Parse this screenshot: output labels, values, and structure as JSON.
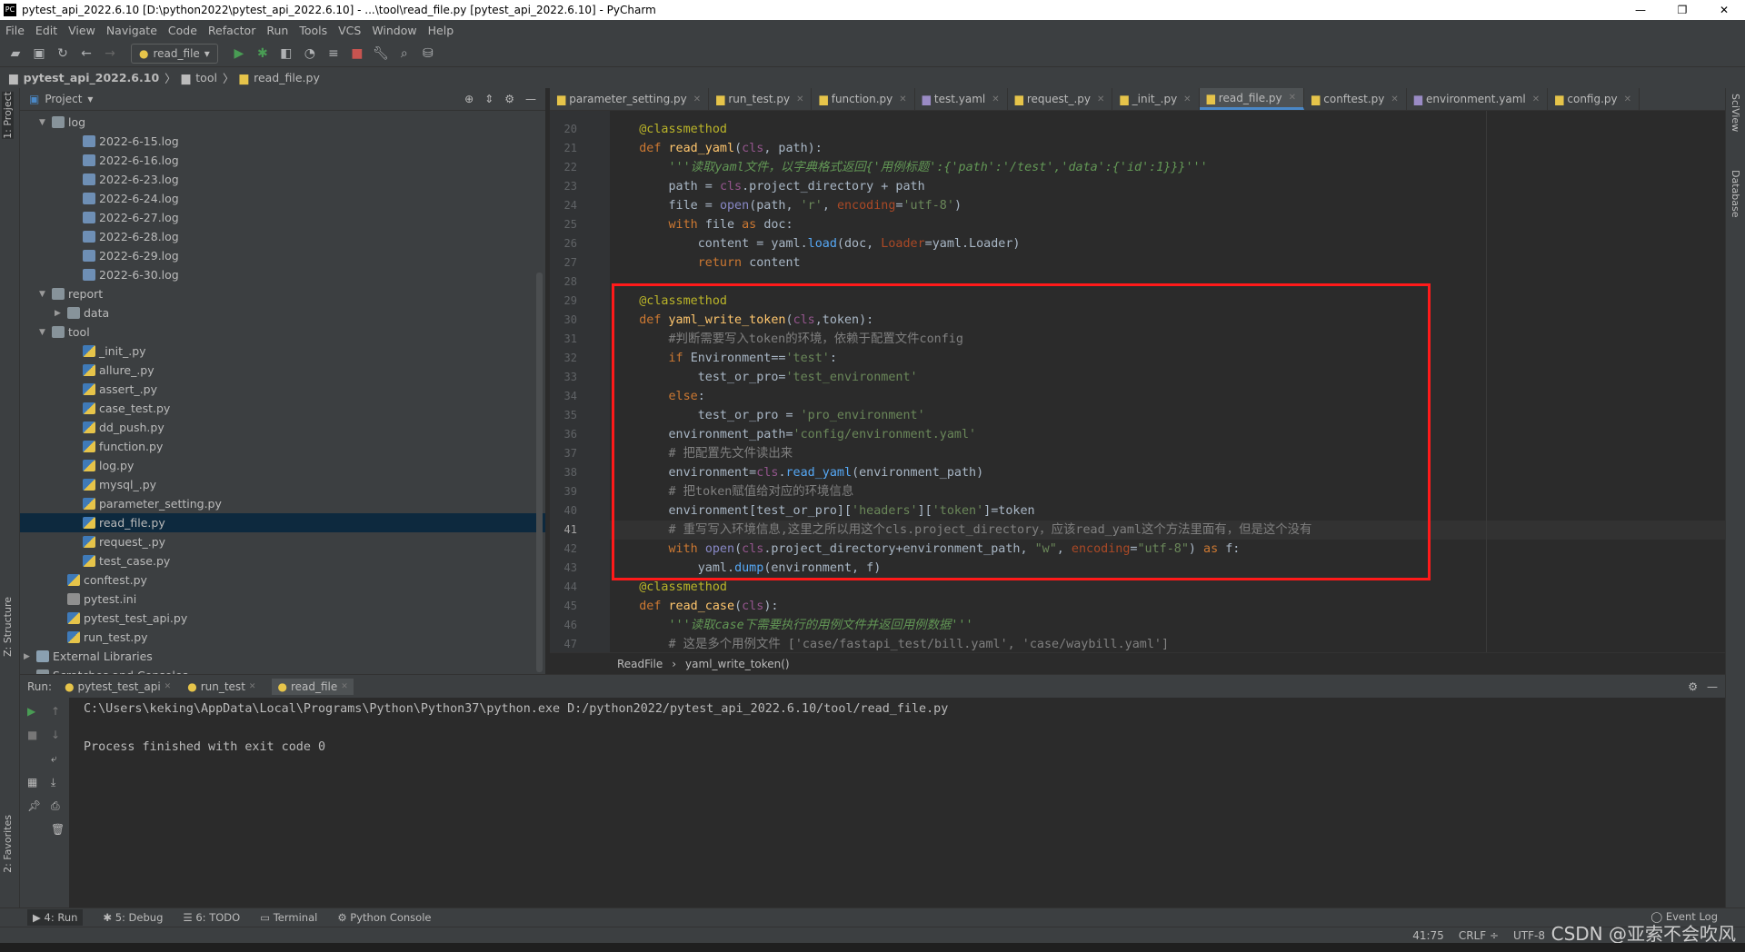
{
  "window": {
    "title": "pytest_api_2022.6.10 [D:\\python2022\\pytest_api_2022.6.10] - ...\\tool\\read_file.py [pytest_api_2022.6.10] - PyCharm",
    "app_icon": "PC"
  },
  "menu": [
    "File",
    "Edit",
    "View",
    "Navigate",
    "Code",
    "Refactor",
    "Run",
    "Tools",
    "VCS",
    "Window",
    "Help"
  ],
  "toolbar": {
    "run_config": "read_file"
  },
  "breadcrumb": [
    "pytest_api_2022.6.10",
    "tool",
    "read_file.py"
  ],
  "left_strip": {
    "project": "1: Project",
    "structure": "Z: Structure",
    "favorites": "2: Favorites"
  },
  "project": {
    "title": "Project",
    "tree": [
      {
        "label": "log",
        "depth": 1,
        "type": "folder",
        "arrow": "▼"
      },
      {
        "label": "2022-6-15.log",
        "depth": 3,
        "type": "log"
      },
      {
        "label": "2022-6-16.log",
        "depth": 3,
        "type": "log"
      },
      {
        "label": "2022-6-23.log",
        "depth": 3,
        "type": "log"
      },
      {
        "label": "2022-6-24.log",
        "depth": 3,
        "type": "log"
      },
      {
        "label": "2022-6-27.log",
        "depth": 3,
        "type": "log"
      },
      {
        "label": "2022-6-28.log",
        "depth": 3,
        "type": "log"
      },
      {
        "label": "2022-6-29.log",
        "depth": 3,
        "type": "log"
      },
      {
        "label": "2022-6-30.log",
        "depth": 3,
        "type": "log"
      },
      {
        "label": "report",
        "depth": 1,
        "type": "folder",
        "arrow": "▼"
      },
      {
        "label": "data",
        "depth": 2,
        "type": "folder",
        "arrow": "▶"
      },
      {
        "label": "tool",
        "depth": 1,
        "type": "folder",
        "arrow": "▼"
      },
      {
        "label": "_init_.py",
        "depth": 3,
        "type": "py"
      },
      {
        "label": "allure_.py",
        "depth": 3,
        "type": "py"
      },
      {
        "label": "assert_.py",
        "depth": 3,
        "type": "py"
      },
      {
        "label": "case_test.py",
        "depth": 3,
        "type": "py"
      },
      {
        "label": "dd_push.py",
        "depth": 3,
        "type": "py"
      },
      {
        "label": "function.py",
        "depth": 3,
        "type": "py"
      },
      {
        "label": "log.py",
        "depth": 3,
        "type": "py"
      },
      {
        "label": "mysql_.py",
        "depth": 3,
        "type": "py"
      },
      {
        "label": "parameter_setting.py",
        "depth": 3,
        "type": "py"
      },
      {
        "label": "read_file.py",
        "depth": 3,
        "type": "py",
        "selected": true
      },
      {
        "label": "request_.py",
        "depth": 3,
        "type": "py"
      },
      {
        "label": "test_case.py",
        "depth": 3,
        "type": "py"
      },
      {
        "label": "conftest.py",
        "depth": 2,
        "type": "py"
      },
      {
        "label": "pytest.ini",
        "depth": 2,
        "type": "ini"
      },
      {
        "label": "pytest_test_api.py",
        "depth": 2,
        "type": "py"
      },
      {
        "label": "run_test.py",
        "depth": 2,
        "type": "py"
      },
      {
        "label": "External Libraries",
        "depth": 0,
        "type": "lib",
        "arrow": "▶"
      },
      {
        "label": "Scratches and Consoles",
        "depth": 0,
        "type": "folder"
      }
    ]
  },
  "tabs": [
    {
      "label": "parameter_setting.py"
    },
    {
      "label": "run_test.py"
    },
    {
      "label": "function.py"
    },
    {
      "label": "test.yaml"
    },
    {
      "label": "request_.py"
    },
    {
      "label": "_init_.py"
    },
    {
      "label": "read_file.py",
      "active": true
    },
    {
      "label": "conftest.py"
    },
    {
      "label": "environment.yaml"
    },
    {
      "label": "config.py"
    }
  ],
  "editor": {
    "first_line": 20,
    "current_line": 41,
    "lines": [
      [
        [
          "    "
        ],
        [
          "@classmethod",
          "dec"
        ]
      ],
      [
        [
          "    "
        ],
        [
          "def ",
          "kw"
        ],
        [
          "read_yaml",
          "fn"
        ],
        [
          "("
        ],
        [
          "cls",
          "self"
        ],
        [
          ", path):"
        ]
      ],
      [
        [
          "        "
        ],
        [
          "'''读取yaml文件，以字典格式返回{'用例标题':{'path':'/test','data':{'id':1}}}'''",
          "doc"
        ]
      ],
      [
        [
          "        path = "
        ],
        [
          "cls",
          "self"
        ],
        [
          ".project_directory + path"
        ]
      ],
      [
        [
          "        file = "
        ],
        [
          "open",
          "bi"
        ],
        [
          "(path, "
        ],
        [
          "'r'",
          "str"
        ],
        [
          ", "
        ],
        [
          "encoding",
          "param"
        ],
        [
          "="
        ],
        [
          "'utf-8'",
          "str"
        ],
        [
          ")"
        ]
      ],
      [
        [
          "        "
        ],
        [
          "with ",
          "kw"
        ],
        [
          "file "
        ],
        [
          "as ",
          "kw"
        ],
        [
          "doc:"
        ]
      ],
      [
        [
          "            content = yaml."
        ],
        [
          "load",
          "call"
        ],
        [
          "(doc, "
        ],
        [
          "Loader",
          "param"
        ],
        [
          "=yaml.Loader)"
        ]
      ],
      [
        [
          "            "
        ],
        [
          "return ",
          "kw"
        ],
        [
          "content"
        ]
      ],
      [
        [
          ""
        ]
      ],
      [
        [
          "    "
        ],
        [
          "@classmethod",
          "dec"
        ]
      ],
      [
        [
          "    "
        ],
        [
          "def ",
          "kw"
        ],
        [
          "yaml_write_token",
          "fn"
        ],
        [
          "("
        ],
        [
          "cls",
          "self"
        ],
        [
          ",token):"
        ]
      ],
      [
        [
          "        "
        ],
        [
          "#判断需要写入token的环境，依赖于配置文件config",
          "cm"
        ]
      ],
      [
        [
          "        "
        ],
        [
          "if ",
          "kw"
        ],
        [
          "Environment=="
        ],
        [
          "'test'",
          "str"
        ],
        [
          ":"
        ]
      ],
      [
        [
          "            test_or_pro="
        ],
        [
          "'test_environment'",
          "str"
        ]
      ],
      [
        [
          "        "
        ],
        [
          "else",
          "kw"
        ],
        [
          ":"
        ]
      ],
      [
        [
          "            test_or_pro = "
        ],
        [
          "'pro_environment'",
          "str"
        ]
      ],
      [
        [
          "        environment_path="
        ],
        [
          "'config/environment.yaml'",
          "str"
        ]
      ],
      [
        [
          "        "
        ],
        [
          "# 把配置先文件读出来",
          "cm"
        ]
      ],
      [
        [
          "        environment="
        ],
        [
          "cls",
          "self"
        ],
        [
          "."
        ],
        [
          "read_yaml",
          "call"
        ],
        [
          "(environment_path)"
        ]
      ],
      [
        [
          "        "
        ],
        [
          "# 把token赋值给对应的环境信息",
          "cm"
        ]
      ],
      [
        [
          "        environment[test_or_pro]["
        ],
        [
          "'headers'",
          "str"
        ],
        [
          "]["
        ],
        [
          "'token'",
          "str"
        ],
        [
          "]=token"
        ]
      ],
      [
        [
          "        "
        ],
        [
          "# 重写写入环境信息,这里之所以用这个cls.project_directory，应该read_yaml这个方法里面有，但是这个没有",
          "cm"
        ]
      ],
      [
        [
          "        "
        ],
        [
          "with ",
          "kw"
        ],
        [
          "open",
          "bi"
        ],
        [
          "("
        ],
        [
          "cls",
          "self"
        ],
        [
          ".project_directory+environment_path, "
        ],
        [
          "\"w\"",
          "str"
        ],
        [
          ", "
        ],
        [
          "encoding",
          "param"
        ],
        [
          "="
        ],
        [
          "\"utf-8\"",
          "str"
        ],
        [
          ") "
        ],
        [
          "as ",
          "kw"
        ],
        [
          "f:"
        ]
      ],
      [
        [
          "            yaml."
        ],
        [
          "dump",
          "call"
        ],
        [
          "(environment, f)"
        ]
      ],
      [
        [
          "    "
        ],
        [
          "@classmethod",
          "dec"
        ]
      ],
      [
        [
          "    "
        ],
        [
          "def ",
          "kw"
        ],
        [
          "read_case",
          "fn"
        ],
        [
          "("
        ],
        [
          "cls",
          "self"
        ],
        [
          "):"
        ]
      ],
      [
        [
          "        "
        ],
        [
          "'''读取case下需要执行的用例文件并返回用例数据'''",
          "doc"
        ]
      ],
      [
        [
          "        "
        ],
        [
          "# 这是多个用例文件 ['case/fastapi_test/bill.yaml', 'case/waybill.yaml']",
          "cm"
        ]
      ]
    ]
  },
  "editor_breadcrumb": [
    "ReadFile",
    "yaml_write_token()"
  ],
  "run": {
    "label": "Run:",
    "tabs": [
      "pytest_test_api",
      "run_test",
      "read_file"
    ],
    "output": [
      "C:\\Users\\keking\\AppData\\Local\\Programs\\Python\\Python37\\python.exe D:/python2022/pytest_api_2022.6.10/tool/read_file.py",
      "",
      "Process finished with exit code 0"
    ]
  },
  "bottom_tabs": [
    "4: Run",
    "5: Debug",
    "6: TODO",
    "Terminal",
    "Python Console"
  ],
  "event_log": "Event Log",
  "status": {
    "position": "41:75",
    "line_sep": "CRLF ÷",
    "encoding": "UTF-8"
  },
  "right_strip": {
    "sciview": "SciView",
    "database": "Database"
  },
  "watermark": "CSDN @亚索不会吹风"
}
